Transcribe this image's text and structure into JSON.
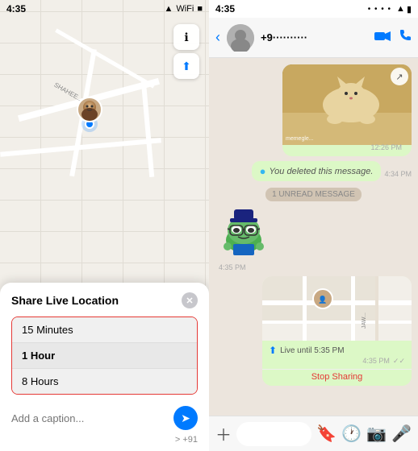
{
  "left": {
    "status_time": "4:35",
    "map_controls": [
      "ℹ",
      "⬆"
    ],
    "share_panel": {
      "title": "Share Live Location",
      "close": "✕",
      "duration_options": [
        "15 Minutes",
        "1 Hour",
        "8 Hours"
      ],
      "selected_index": 1,
      "caption_placeholder": "Add a caption...",
      "country_code": "> +91",
      "send_icon": "➤"
    }
  },
  "right": {
    "status_dots": ".....",
    "header": {
      "back": "‹",
      "phone": "+9··········",
      "video_icon": "📷",
      "call_icon": "📞"
    },
    "messages": [
      {
        "type": "image",
        "source": "memegle...",
        "time": "12:26 PM",
        "share_icon": "↗"
      },
      {
        "type": "deleted",
        "text": "You deleted this message.",
        "time": "4:34 PM"
      },
      {
        "type": "separator",
        "text": "1 UNREAD MESSAGE"
      },
      {
        "type": "sticker",
        "time": "4:35 PM"
      },
      {
        "type": "map",
        "live_text": "Live until 5:35 PM",
        "time": "4:35 PM",
        "stop_label": "Stop Sharing"
      }
    ]
  }
}
